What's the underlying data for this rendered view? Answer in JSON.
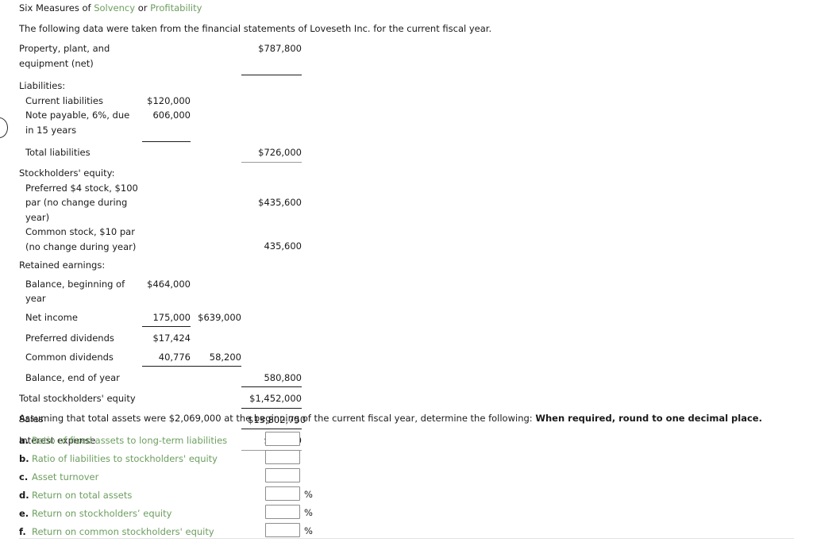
{
  "header": {
    "title_pre": "Six Measures of ",
    "title_link1": "Solvency",
    "title_mid": " or ",
    "title_link2": "Profitability",
    "intro": "The following data were taken from the financial statements of Loveseth Inc. for the current fiscal year."
  },
  "statement": {
    "rows": [
      {
        "label": "Property, plant, and equipment (net)",
        "c1": "",
        "c2": "",
        "c3": "$787,800"
      },
      {
        "label": "Liabilities:",
        "c1": "",
        "c2": "",
        "c3": ""
      },
      {
        "label": "Current liabilities",
        "c1": "$120,000",
        "c2": "",
        "c3": ""
      },
      {
        "label": "Note payable, 6%, due in 15 years",
        "c1": "606,000",
        "c2": "",
        "c3": ""
      },
      {
        "label": "Total liabilities",
        "c1": "",
        "c2": "",
        "c3": "$726,000"
      },
      {
        "label": "Stockholders' equity:",
        "c1": "",
        "c2": "",
        "c3": ""
      },
      {
        "label": "Preferred $4 stock, $100 par (no change during year)",
        "c1": "",
        "c2": "",
        "c3": "$435,600"
      },
      {
        "label": "Common stock, $10 par (no change during year)",
        "c1": "",
        "c2": "",
        "c3": "435,600"
      },
      {
        "label": "Retained earnings:",
        "c1": "",
        "c2": "",
        "c3": ""
      },
      {
        "label": "Balance, beginning of year",
        "c1": "$464,000",
        "c2": "",
        "c3": ""
      },
      {
        "label": "Net income",
        "c1": "175,000",
        "c2": "$639,000",
        "c3": ""
      },
      {
        "label": "Preferred dividends",
        "c1": "$17,424",
        "c2": "",
        "c3": ""
      },
      {
        "label": "Common dividends",
        "c1": "40,776",
        "c2": "58,200",
        "c3": ""
      },
      {
        "label": "Balance, end of year",
        "c1": "",
        "c2": "",
        "c3": "580,800"
      },
      {
        "label": "Total stockholders' equity",
        "c1": "",
        "c2": "",
        "c3": "$1,452,000"
      },
      {
        "label": "Sales",
        "c1": "",
        "c2": "",
        "c3": "$13,802,750"
      },
      {
        "label": "Interest expense",
        "c1": "",
        "c2": "",
        "c3": "$36,360"
      }
    ]
  },
  "assumption": {
    "text": "Assuming that total assets were $2,069,000 at the beginning of the current fiscal year, determine the following: ",
    "bold": "When required, round to one decimal place."
  },
  "questions": [
    {
      "letter": "a.",
      "label": "Ratio of fixed assets to long-term liabilities",
      "value": "",
      "suffix": ""
    },
    {
      "letter": "b.",
      "label": "Ratio of liabilities to stockholders' equity",
      "value": "",
      "suffix": ""
    },
    {
      "letter": "c.",
      "label": "Asset turnover",
      "value": "",
      "suffix": ""
    },
    {
      "letter": "d.",
      "label": "Return on total assets",
      "value": "",
      "suffix": "%"
    },
    {
      "letter": "e.",
      "label": "Return on stockholders’ equity",
      "value": "",
      "suffix": "%"
    },
    {
      "letter": "f.",
      "label": "Return on common stockholders' equity",
      "value": "",
      "suffix": "%"
    }
  ],
  "colors": {
    "link_green": "#6c9e5f",
    "text": "#1a1a1a",
    "rule": "#1c1c1c",
    "rule_light": "#9b9b9b",
    "input_border": "#8d8d8d"
  }
}
